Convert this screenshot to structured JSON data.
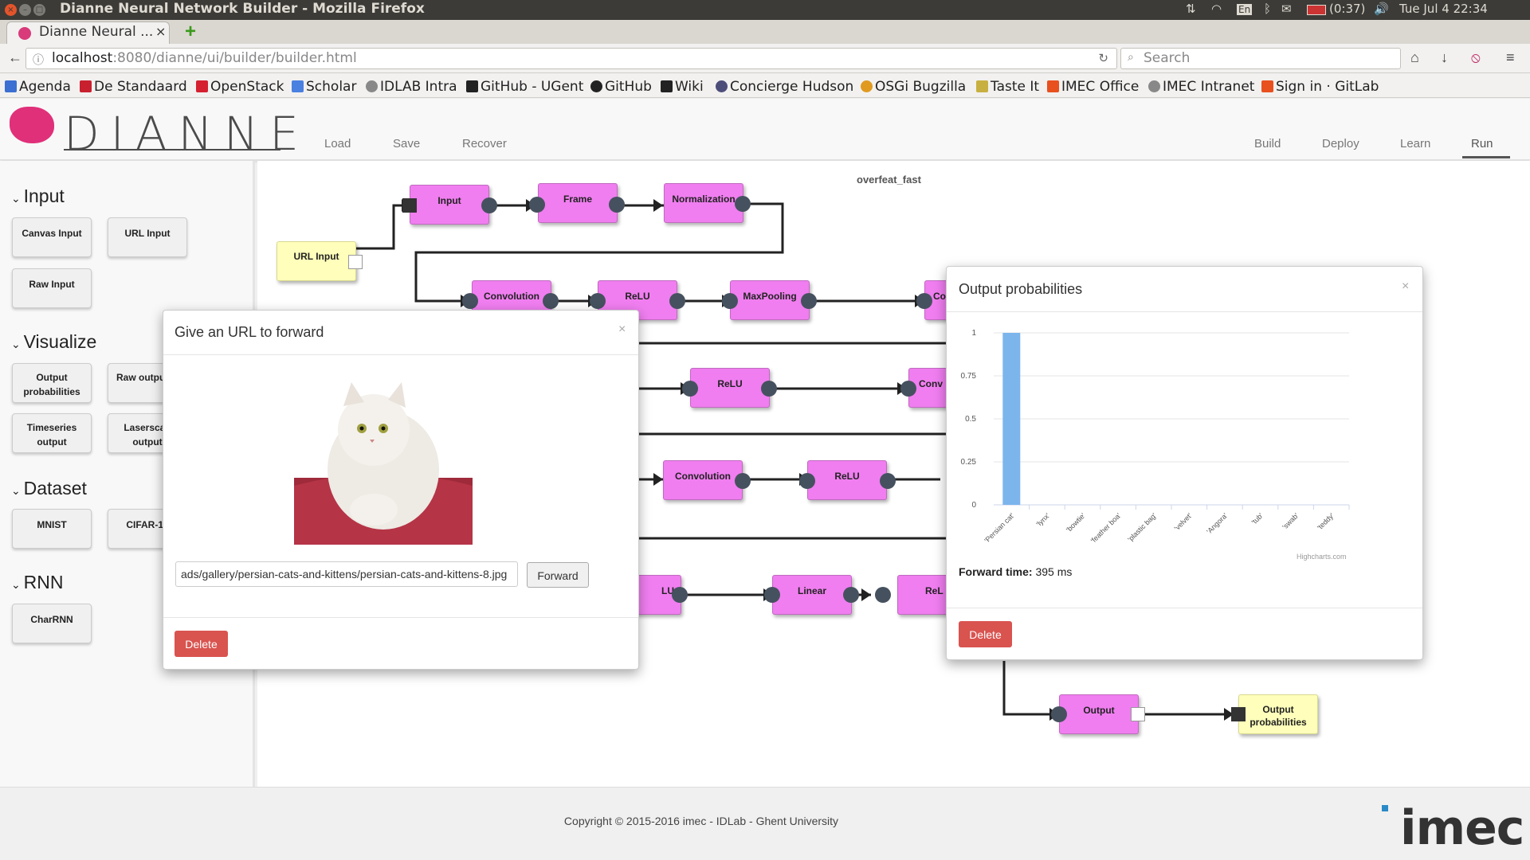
{
  "window": {
    "title": "Dianne Neural Network Builder - Mozilla Firefox"
  },
  "system_tray": {
    "battery": "(0:37)",
    "datetime": "Tue Jul  4 22:34",
    "lang": "En"
  },
  "browser": {
    "tab_title": "Dianne Neural ...",
    "url_host": "localhost",
    "url_path": ":8080/dianne/ui/builder/builder.html",
    "search_placeholder": "Search",
    "bookmarks": [
      "Agenda",
      "De Standaard",
      "OpenStack",
      "Scholar",
      "IDLAB Intra",
      "GitHub - UGent",
      "GitHub",
      "Wiki",
      "Concierge Hudson",
      "OSGi Bugzilla",
      "Taste It",
      "IMEC Office",
      "IMEC Intranet",
      "Sign in · GitLab"
    ]
  },
  "app": {
    "logo": "DIANNE",
    "menu_left": [
      "Load",
      "Save",
      "Recover"
    ],
    "menu_right": [
      "Build",
      "Deploy",
      "Learn",
      "Run"
    ],
    "active_tab": "Run"
  },
  "palette": {
    "categories": [
      {
        "name": "Input",
        "items": [
          "Canvas Input",
          "URL Input",
          "Raw Input"
        ]
      },
      {
        "name": "Visualize",
        "items": [
          "Output probabilities",
          "Raw output",
          "Timeseries output",
          "Laserscan output"
        ]
      },
      {
        "name": "Dataset",
        "items": [
          "MNIST",
          "CIFAR-10"
        ]
      },
      {
        "name": "RNN",
        "items": [
          "CharRNN"
        ]
      }
    ]
  },
  "canvas": {
    "network_name": "overfeat_fast",
    "modules": {
      "url_input": "URL Input",
      "input": "Input",
      "frame": "Frame",
      "normalization": "Normalization",
      "conv1": "Convolution",
      "relu1": "ReLU",
      "maxpool1": "MaxPooling",
      "conv2": "Co",
      "relu2": "ReLU",
      "conv3": "Conv",
      "conv4": "Convolution",
      "relu3": "ReLU",
      "relu4": "LU",
      "linear": "Linear",
      "relu5": "ReL",
      "output": "Output",
      "output_probs": "Output probabilities"
    }
  },
  "url_dialog": {
    "title": "Give an URL to forward",
    "close": "×",
    "url_value": "ads/gallery/persian-cats-and-kittens/persian-cats-and-kittens-8.jpg",
    "forward_label": "Forward",
    "delete_label": "Delete"
  },
  "prob_dialog": {
    "title": "Output probabilities",
    "close": "×",
    "forward_time_label": "Forward time:",
    "forward_time_value": "395 ms",
    "credit": "Highcharts.com",
    "delete_label": "Delete"
  },
  "chart_data": {
    "type": "bar",
    "categories": [
      "'Persian cat'",
      "'lynx'",
      "'bowtie'",
      "'feather boa'",
      "'plastic bag'",
      "'velvet'",
      "'Angora'",
      "'tub'",
      "'swab'",
      "'teddy'"
    ],
    "values": [
      1.0,
      0,
      0,
      0,
      0,
      0,
      0,
      0,
      0,
      0
    ],
    "ylim": [
      0,
      1
    ],
    "yticks": [
      "0",
      "0.25",
      "0.5",
      "0.75",
      "1"
    ],
    "color": "#7cb5ec",
    "title": "",
    "xlabel": "",
    "ylabel": ""
  },
  "footer": {
    "copyright": "Copyright © 2015-2016 imec - IDLab - Ghent University",
    "brand": "imec"
  }
}
